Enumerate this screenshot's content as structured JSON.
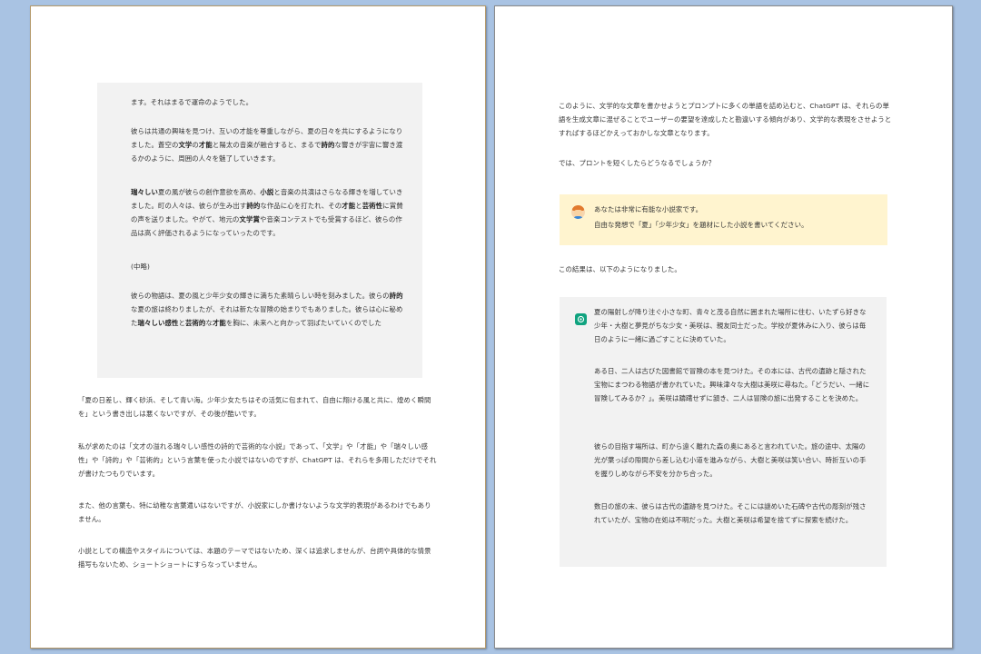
{
  "left_page": {
    "quote_box": {
      "p1": "ます。それはまるで運命のようでした。",
      "p2": {
        "a": "彼らは共通の興味を見つけ、互いの才能を尊重しながら、夏の日々を共にするようになりました。蒼空の",
        "b1": "文学",
        "c": "の",
        "b2": "才能",
        "d": "と陽太の音楽が融合すると、まるで",
        "b3": "詩的",
        "e": "な響きが宇宙に響き渡るかのように、周囲の人々を魅了していきます。"
      },
      "p3": {
        "b1": "瑞々しい",
        "a": "夏の風が彼らの創作意欲を高め、",
        "b2": "小説",
        "c": "と音楽の共演はさらなる輝きを増していきました。町の人々は、彼らが生み出す",
        "b3": "詩的",
        "d": "な作品に心を打たれ、その",
        "b4": "才能",
        "e": "と",
        "b5": "芸術性",
        "f": "に賞賛の声を送りました。やがて、地元の",
        "b6": "文学賞",
        "g": "や音楽コンテストでも受賞するほど、彼らの作品は高く評価されるようになっていったのです。"
      },
      "p4": "(中略)",
      "p5": {
        "a": "彼らの物語は、夏の風と少年少女の輝きに満ちた素晴らしい時を刻みました。彼らの",
        "b1": "詩的",
        "c": "な夏の旅は終わりましたが、それは新たな冒険の始まりでもありました。彼らは心に秘めた",
        "b2": "瑞々しい感性",
        "d": "と",
        "b3": "芸術的",
        "e": "な",
        "b4": "才能",
        "f": "を胸に、未来へと向かって羽ばたいていくのでした"
      }
    },
    "body": {
      "p1": "「夏の日差し、輝く砂浜、そして青い海。少年少女たちはその活気に包まれて、自由に翔ける風と共に、煌めく瞬間を」という書き出しは悪くないですが、その後が酷いです。",
      "p2": "私が求めたのは「文才の溢れる瑞々しい感性の詩的で芸術的な小説」であって、「文学」や「才能」や「瑞々しい感性」や「詩的」や「芸術的」という言葉を使った小説ではないのですが、ChatGPT は、それらを多用しただけでそれが書けたつもりでいます。",
      "p3": "また、他の言葉も、特に幼稚な言葉遣いはないですが、小説家にしか書けないような文学的表現があるわけでもありません。",
      "p4": "小説としての構造やスタイルについては、本題のテーマではないため、深くは追求しませんが、台詞や具体的な情景描写もないため、ショートショートにすらなっていません。"
    }
  },
  "right_page": {
    "p1": "このように、文学的な文章を書かせようとプロンプトに多くの単語を詰め込むと、ChatGPT は、それらの単語を生成文章に混ぜることでユーザーの要望を達成したと勘違いする傾向があり、文学的な表現をさせようとすればするほどかえっておかしな文章となります。",
    "p2": "では、プロントを短くしたらどうなるでしょうか？",
    "prompt_box": {
      "line1": "あなたは非常に有能な小説家です。",
      "line2": "自由な発想で「夏」「少年少女」を題材にした小説を書いてください。"
    },
    "p3": "この結果は、以下のようになりました。",
    "response_box": {
      "p1": "夏の陽射しが降り注ぐ小さな町、青々と茂る自然に囲まれた場所に住む、いたずら好きな少年・大樹と夢見がちな少女・美咲は、親友同士だった。学校が夏休みに入り、彼らは毎日のように一緒に過ごすことに決めていた。",
      "p2": "ある日、二人は古びた図書館で冒険の本を見つけた。その本には、古代の遺跡と隠された宝物にまつわる物語が書かれていた。興味津々な大樹は美咲に尋ねた。「どうだい、一緒に冒険してみるか？」。美咲は躊躇せずに頷き、二人は冒険の旅に出発することを決めた。",
      "p3": "彼らの目指す場所は、町から遠く離れた森の奥にあると言われていた。旅の途中、太陽の光が葉っぱの隙間から差し込む小道を進みながら、大樹と美咲は笑い合い、時折互いの手を握りしめながら不安を分かち合った。",
      "p4": "数日の旅の末、彼らは古代の遺跡を見つけた。そこには謎めいた石碑や古代の彫刻が残されていたが、宝物の在処は不明だった。大樹と美咲は希望を捨てずに探索を続けた。"
    }
  },
  "icons": {
    "user_avatar": "user-avatar-icon",
    "chatgpt": "chatgpt-logo-icon"
  },
  "colors": {
    "background": "#a9c3e3",
    "quote_box": "#f2f2f2",
    "prompt_box": "#fff4cf",
    "chatgpt_green": "#10a37f"
  }
}
